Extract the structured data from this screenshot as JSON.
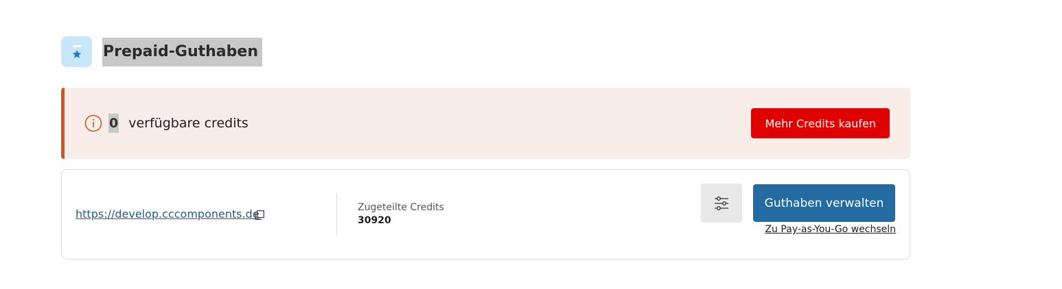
{
  "header": {
    "title": "Prepaid-Guthaben",
    "icon": "wallet-star-icon"
  },
  "alert": {
    "icon": "info-icon",
    "count": "0",
    "text": "verfügbare credits",
    "buy_label": "Mehr Credits kaufen",
    "accent": "#d2561f",
    "button_color": "#e10000"
  },
  "card": {
    "domain": "https://develop.cccomponents.de",
    "copy_icon": "copy-icon",
    "credits_label": "Zugeteilte Credits",
    "credits_value": "30920",
    "filter_icon": "sliders-icon",
    "manage_label": "Guthaben verwalten",
    "switch_label": "Zu Pay-as-You-Go wechseln",
    "primary_color": "#236ba0"
  }
}
